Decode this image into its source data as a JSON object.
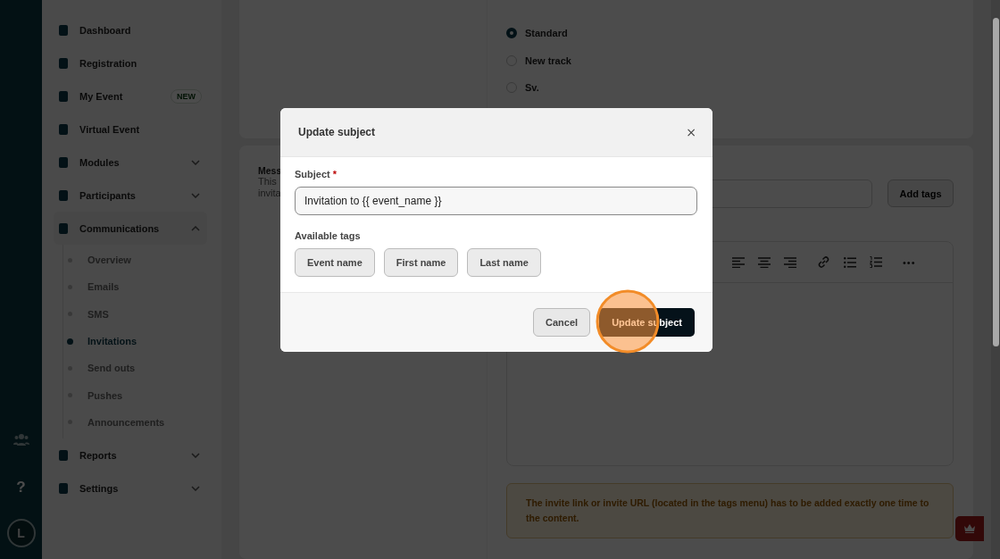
{
  "rail": {
    "help": "?",
    "avatar": "L"
  },
  "sidebar": {
    "items": [
      {
        "label": "Dashboard"
      },
      {
        "label": "Registration"
      },
      {
        "label": "My Event",
        "badge": "NEW"
      },
      {
        "label": "Virtual Event"
      },
      {
        "label": "Modules",
        "expanded": false
      },
      {
        "label": "Participants",
        "expanded": false
      },
      {
        "label": "Communications",
        "expanded": true,
        "children": [
          {
            "label": "Overview",
            "selected": false
          },
          {
            "label": "Emails",
            "selected": false
          },
          {
            "label": "SMS",
            "selected": false
          },
          {
            "label": "Invitations",
            "selected": true
          },
          {
            "label": "Send outs",
            "selected": false
          },
          {
            "label": "Pushes",
            "selected": false
          },
          {
            "label": "Announcements",
            "selected": false
          }
        ]
      },
      {
        "label": "Reports",
        "expanded": false
      },
      {
        "label": "Settings",
        "expanded": false
      }
    ]
  },
  "registration_track": {
    "options": [
      {
        "label": "Standard",
        "selected": true
      },
      {
        "label": "New track",
        "selected": false
      },
      {
        "label": "Sv.",
        "selected": false
      }
    ]
  },
  "message_section": {
    "title": "Mess",
    "description": [
      "This",
      "invita"
    ],
    "add_tags_button": "Add tags",
    "toolbar_more": "•••",
    "notice": "The invite link or invite URL (located in the tags menu) has to be added exactly one time to the content."
  },
  "modal": {
    "title": "Update subject",
    "close": "×",
    "subject_label": "Subject",
    "required_mark": "*",
    "subject_value": "Invitation to {{ event_name }}",
    "tags_label": "Available tags",
    "tags": [
      "Event name",
      "First name",
      "Last name"
    ],
    "cancel_button": "Cancel",
    "submit_button": "Update subject"
  }
}
